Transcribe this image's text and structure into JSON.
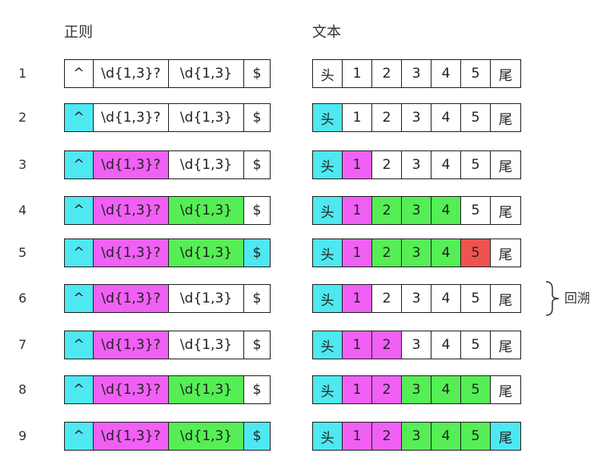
{
  "headers": {
    "regex": "正则",
    "text": "文本"
  },
  "regex_tokens": [
    "^",
    "\\d{1,3}?",
    "\\d{1,3}",
    "$"
  ],
  "text_tokens": [
    "头",
    "1",
    "2",
    "3",
    "4",
    "5",
    "尾"
  ],
  "colors": {
    "cyan": "#4ee8f0",
    "magenta": "#f060f5",
    "green": "#55ee55",
    "red": "#ef5350",
    "white": "#ffffff"
  },
  "steps": [
    {
      "num": "1",
      "regex": [
        "white",
        "white",
        "white",
        "white"
      ],
      "text": [
        "white",
        "white",
        "white",
        "white",
        "white",
        "white",
        "white"
      ]
    },
    {
      "num": "2",
      "regex": [
        "cyan",
        "white",
        "white",
        "white"
      ],
      "text": [
        "cyan",
        "white",
        "white",
        "white",
        "white",
        "white",
        "white"
      ]
    },
    {
      "num": "3",
      "regex": [
        "cyan",
        "magenta",
        "white",
        "white"
      ],
      "text": [
        "cyan",
        "magenta",
        "white",
        "white",
        "white",
        "white",
        "white"
      ]
    },
    {
      "num": "4",
      "regex": [
        "cyan",
        "magenta",
        "green",
        "white"
      ],
      "text": [
        "cyan",
        "magenta",
        "green",
        "green",
        "green",
        "white",
        "white"
      ]
    },
    {
      "num": "5",
      "regex": [
        "cyan",
        "magenta",
        "green",
        "cyan"
      ],
      "text": [
        "cyan",
        "magenta",
        "green",
        "green",
        "green",
        "red",
        "white"
      ]
    },
    {
      "num": "6",
      "regex": [
        "cyan",
        "magenta",
        "white",
        "white"
      ],
      "text": [
        "cyan",
        "magenta",
        "white",
        "white",
        "white",
        "white",
        "white"
      ]
    },
    {
      "num": "7",
      "regex": [
        "cyan",
        "magenta",
        "white",
        "white"
      ],
      "text": [
        "cyan",
        "magenta",
        "magenta",
        "white",
        "white",
        "white",
        "white"
      ]
    },
    {
      "num": "8",
      "regex": [
        "cyan",
        "magenta",
        "green",
        "white"
      ],
      "text": [
        "cyan",
        "magenta",
        "magenta",
        "green",
        "green",
        "green",
        "white"
      ]
    },
    {
      "num": "9",
      "regex": [
        "cyan",
        "magenta",
        "green",
        "cyan"
      ],
      "text": [
        "cyan",
        "magenta",
        "magenta",
        "green",
        "green",
        "green",
        "cyan"
      ]
    }
  ],
  "annotation": {
    "label": "回溯"
  }
}
